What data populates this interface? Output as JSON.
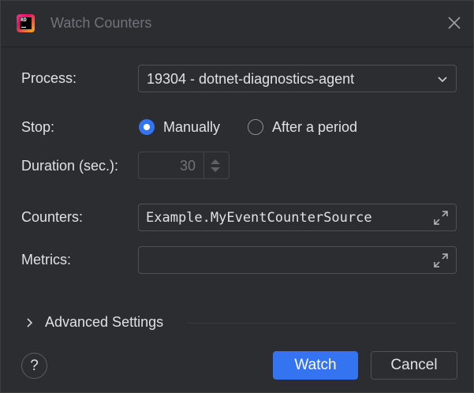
{
  "window": {
    "title": "Watch Counters"
  },
  "form": {
    "process": {
      "label": "Process:",
      "value": "19304 - dotnet-diagnostics-agent"
    },
    "stop": {
      "label": "Stop:",
      "options": [
        {
          "label": "Manually",
          "selected": true
        },
        {
          "label": "After a period",
          "selected": false
        }
      ]
    },
    "duration": {
      "label": "Duration (sec.):",
      "value": "30"
    },
    "counters": {
      "label": "Counters:",
      "value": "Example.MyEventCounterSource"
    },
    "metrics": {
      "label": "Metrics:",
      "value": ""
    }
  },
  "advanced": {
    "label": "Advanced Settings"
  },
  "footer": {
    "help_label": "?",
    "watch_label": "Watch",
    "cancel_label": "Cancel"
  },
  "colors": {
    "accent": "#3574f0",
    "background": "#2b2d30",
    "text": "#dfe1e5"
  }
}
